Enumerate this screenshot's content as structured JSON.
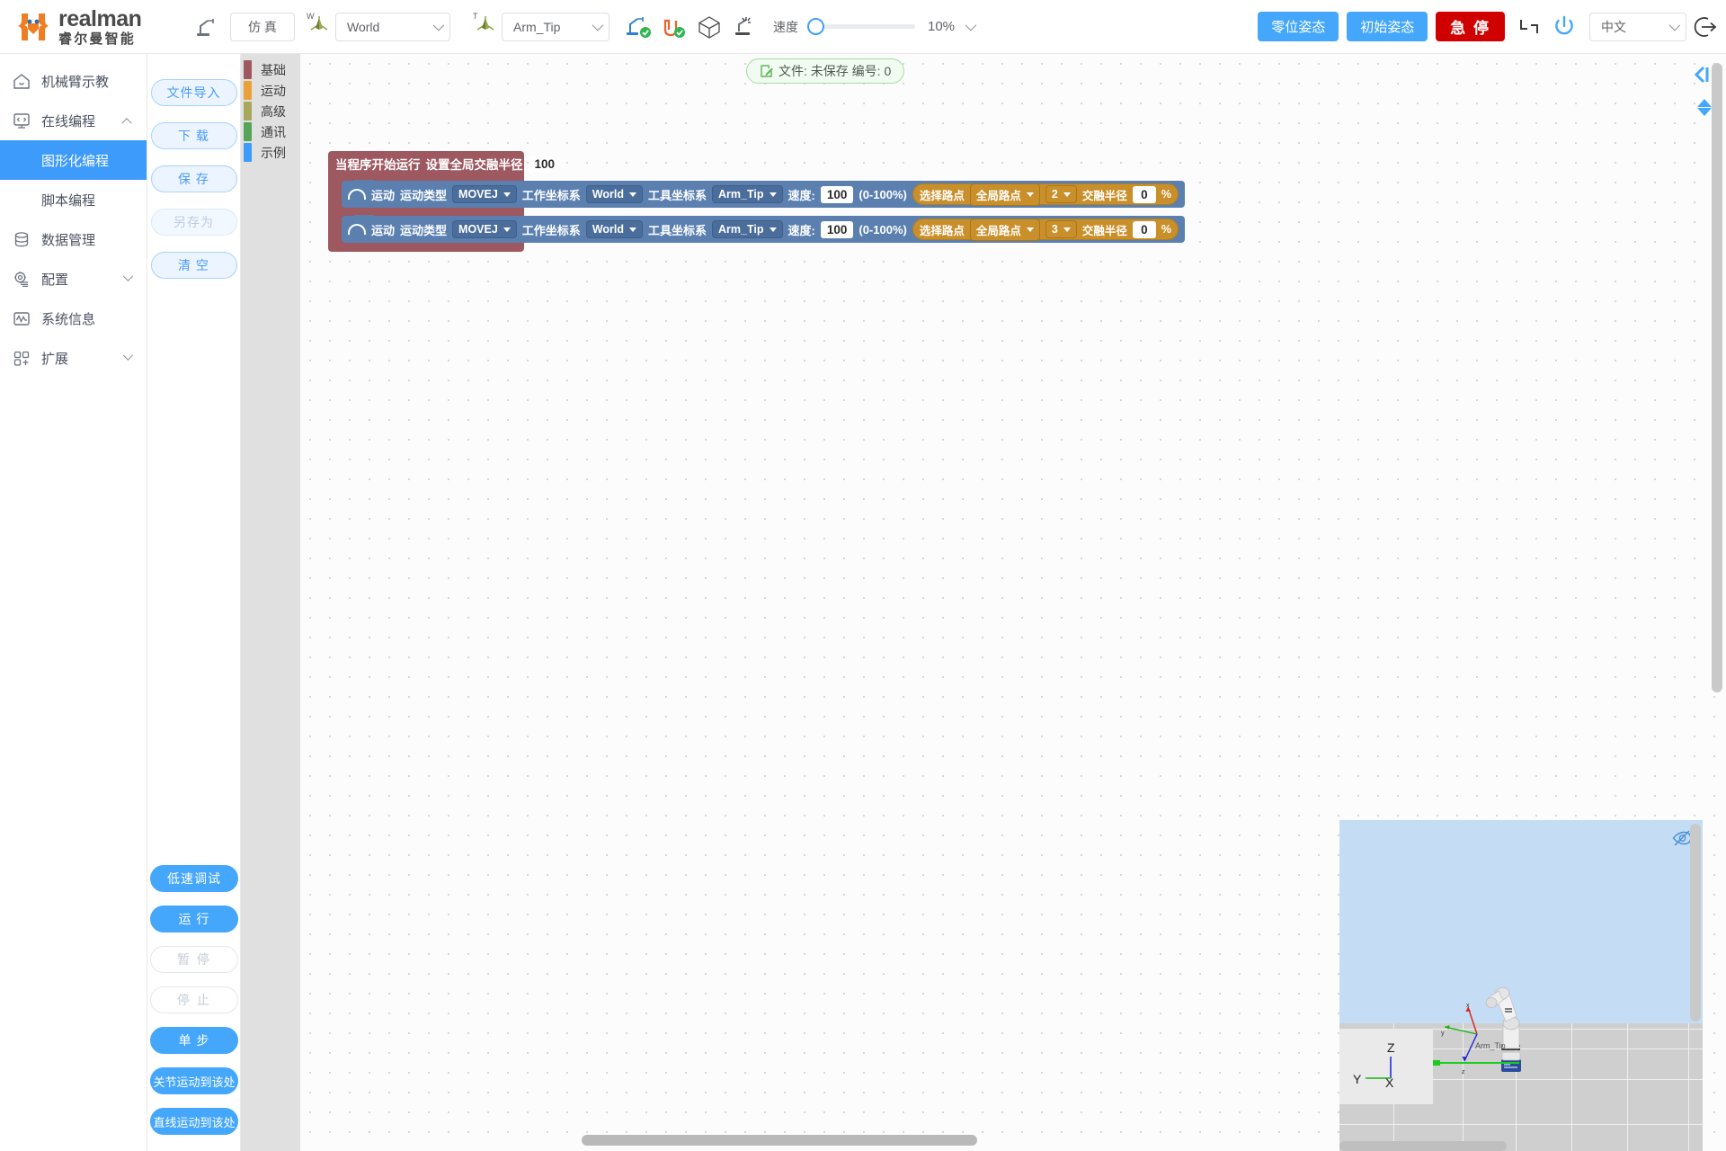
{
  "brand": {
    "en": "realman",
    "cn": "睿尔曼智能"
  },
  "topbar": {
    "teach_icon": "robot-arm-icon",
    "sim_button": "仿 真",
    "work_frame": {
      "tag": "W",
      "value": "World"
    },
    "tool_frame": {
      "tag": "T",
      "value": "Arm_Tip"
    },
    "status_icons": [
      "robot-connected-icon",
      "cable-connected-icon",
      "cube-icon",
      "collision-icon"
    ],
    "speed_label": "速度",
    "speed_value": "10%",
    "zero_pose_button": "零位姿态",
    "init_pose_button": "初始姿态",
    "estop_button": "急 停",
    "joint_icon": "joint-angle-icon",
    "power_icon": "power-icon",
    "language": "中文",
    "logout_icon": "logout-icon"
  },
  "sidebar": {
    "items": [
      {
        "label": "机械臂示教",
        "icon": "home-icon",
        "type": "item",
        "chevron": ""
      },
      {
        "label": "在线编程",
        "icon": "code-monitor-icon",
        "type": "group",
        "chevron": "up"
      },
      {
        "label": "图形化编程",
        "icon": "",
        "type": "sub",
        "active": true
      },
      {
        "label": "脚本编程",
        "icon": "",
        "type": "sub",
        "active": false
      },
      {
        "label": "数据管理",
        "icon": "database-icon",
        "type": "item",
        "chevron": ""
      },
      {
        "label": "配置",
        "icon": "gear-icon",
        "type": "group",
        "chevron": "down"
      },
      {
        "label": "系统信息",
        "icon": "waveform-icon",
        "type": "item",
        "chevron": ""
      },
      {
        "label": "扩展",
        "icon": "grid-blocks-icon",
        "type": "group",
        "chevron": "down"
      }
    ]
  },
  "file_panel": {
    "buttons": [
      {
        "label": "文件导入",
        "state": "enabled"
      },
      {
        "label": "下 载",
        "state": "enabled"
      },
      {
        "label": "保 存",
        "state": "enabled"
      },
      {
        "label": "另存为",
        "state": "disabled"
      },
      {
        "label": "清 空",
        "state": "enabled"
      }
    ]
  },
  "run_panel": {
    "buttons": [
      {
        "label": "低速调试",
        "style": "solid"
      },
      {
        "label": "运 行",
        "style": "solid"
      },
      {
        "label": "暂 停",
        "style": "ghost"
      },
      {
        "label": "停 止",
        "style": "ghost"
      },
      {
        "label": "单 步",
        "style": "solid"
      },
      {
        "label": "关节运动到该处",
        "style": "solid-small"
      },
      {
        "label": "直线运动到该处",
        "style": "solid-small"
      }
    ]
  },
  "categories": [
    {
      "label": "基础",
      "color": "#9d5860"
    },
    {
      "label": "运动",
      "color": "#e9a13b"
    },
    {
      "label": "高级",
      "color": "#a8a75b"
    },
    {
      "label": "通讯",
      "color": "#55a457"
    },
    {
      "label": "示例",
      "color": "#3d9bfb"
    }
  ],
  "workspace": {
    "file_badge": {
      "icon": "edit-file-icon",
      "text": "文件: 未保存  编号: 0"
    },
    "collapse_icon": "collapse-left-icon",
    "scroll_up_icon": "triangle-up-icon",
    "scroll_down_icon": "triangle-down-icon",
    "hat_block": {
      "label_start": "当程序开始运行",
      "label_radius": "设置全局交融半径",
      "radius_value": "100",
      "percent": "%"
    },
    "move_blocks": [
      {
        "icon": "arc-motion-icon",
        "label_motion": "运动",
        "label_motion_type": "运动类型",
        "motion_type": "MOVEJ",
        "label_work_frame": "工作坐标系",
        "work_frame": "World",
        "label_tool_frame": "工具坐标系",
        "tool_frame": "Arm_Tip",
        "label_speed": "速度:",
        "speed": "100",
        "speed_range": "(0-100%)",
        "label_pick_point": "选择路点",
        "point_source": "全局路点",
        "point_index": "2",
        "label_blend": "交融半径",
        "blend": "0",
        "percent": "%"
      },
      {
        "icon": "arc-motion-icon",
        "label_motion": "运动",
        "label_motion_type": "运动类型",
        "motion_type": "MOVEJ",
        "label_work_frame": "工作坐标系",
        "work_frame": "World",
        "label_tool_frame": "工具坐标系",
        "tool_frame": "Arm_Tip",
        "label_speed": "速度:",
        "speed": "100",
        "speed_range": "(0-100%)",
        "label_pick_point": "选择路点",
        "point_source": "全局路点",
        "point_index": "3",
        "label_blend": "交融半径",
        "blend": "0",
        "percent": "%"
      }
    ]
  },
  "viewport": {
    "eye_icon": "eye-off-icon",
    "tip_label": "Arm_Tip",
    "axis_z": "Z",
    "axis_y": "Y",
    "axis_x": "X",
    "gizmo_x": "x",
    "gizmo_y": "y",
    "gizmo_z": "z"
  },
  "colors": {
    "accent": "#45a7fb",
    "danger": "#d10000",
    "hat_block": "#9d5860",
    "move_block": "#5b80b0",
    "orange_block": "#c98f2a"
  }
}
